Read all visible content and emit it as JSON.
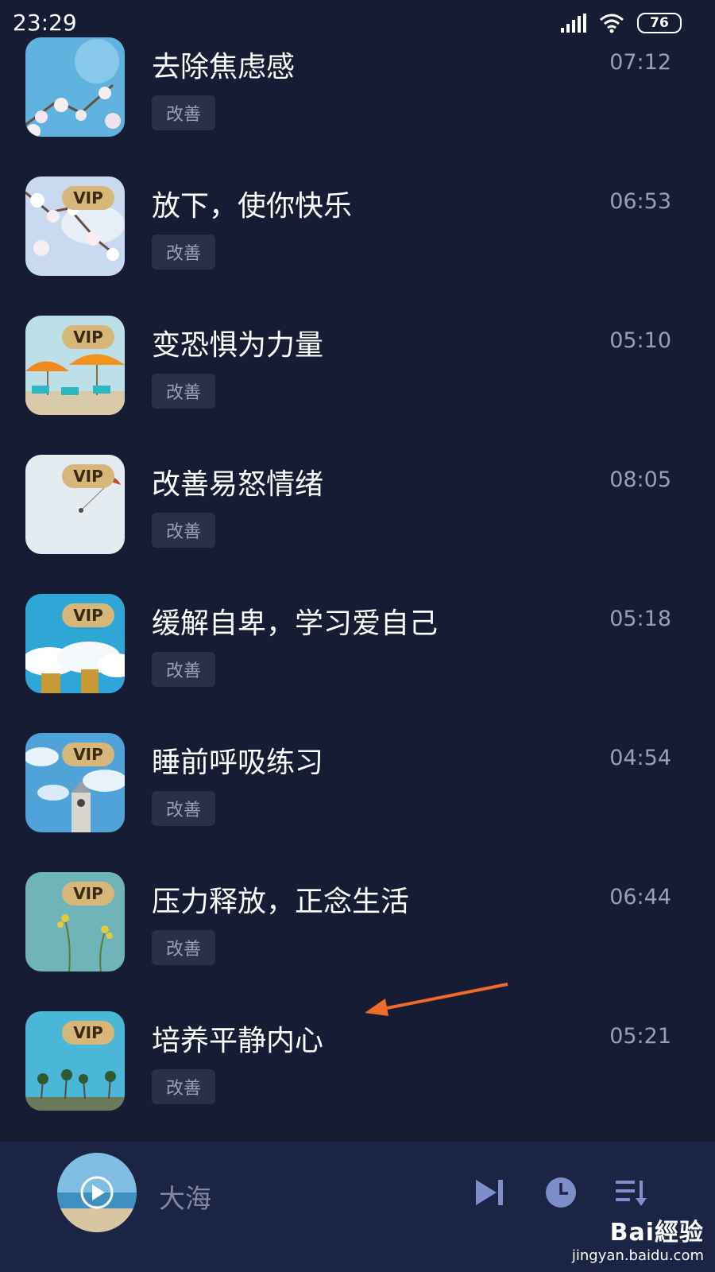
{
  "status": {
    "time": "23:29",
    "battery": "76"
  },
  "items": [
    {
      "title": "去除焦虑感",
      "tag": "改善",
      "duration": "07:12",
      "vip": false,
      "icon": "blossom-sky-image"
    },
    {
      "title": "放下，使你快乐",
      "tag": "改善",
      "duration": "06:53",
      "vip": true,
      "vip_label": "VIP",
      "icon": "blossom-sky-image"
    },
    {
      "title": "变恐惧为力量",
      "tag": "改善",
      "duration": "05:10",
      "vip": true,
      "vip_label": "VIP",
      "icon": "beach-umbrellas-image"
    },
    {
      "title": "改善易怒情绪",
      "tag": "改善",
      "duration": "08:05",
      "vip": true,
      "vip_label": "VIP",
      "icon": "parasailing-image"
    },
    {
      "title": "缓解自卑，学习爱自己",
      "tag": "改善",
      "duration": "05:18",
      "vip": true,
      "vip_label": "VIP",
      "icon": "clouds-buildings-image"
    },
    {
      "title": "睡前呼吸练习",
      "tag": "改善",
      "duration": "04:54",
      "vip": true,
      "vip_label": "VIP",
      "icon": "clock-tower-image"
    },
    {
      "title": "压力释放，正念生活",
      "tag": "改善",
      "duration": "06:44",
      "vip": true,
      "vip_label": "VIP",
      "icon": "yellow-flowers-image"
    },
    {
      "title": "培养平静内心",
      "tag": "改善",
      "duration": "05:21",
      "vip": true,
      "vip_label": "VIP",
      "icon": "palm-trees-image"
    }
  ],
  "player": {
    "title": "大海"
  },
  "watermark": {
    "logo": "Bai經验",
    "url": "jingyan.baidu.com"
  },
  "colors": {
    "background": "#161c33",
    "player_bar": "#1b2444",
    "vip_badge": "#d7b67a",
    "annotation_arrow": "#f26a2a"
  }
}
